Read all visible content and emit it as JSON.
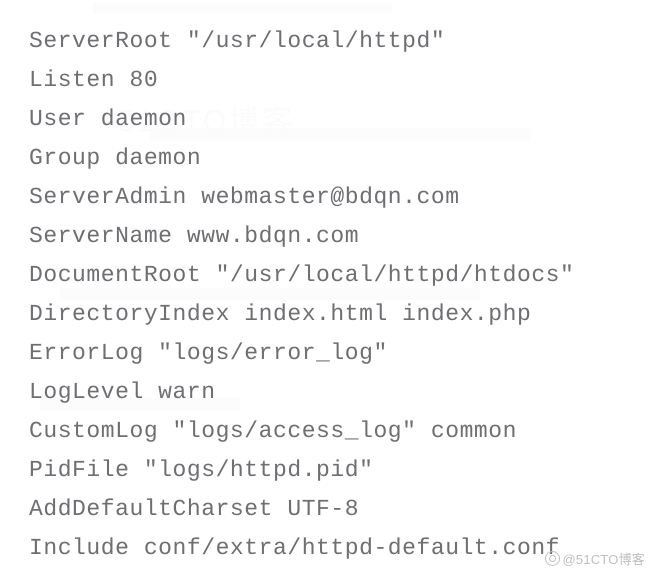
{
  "document": {
    "kind": "apache-httpd-config-listing",
    "background_color": "#ffffff",
    "text_color": "#6f6f73",
    "lines": [
      "ServerRoot \"/usr/local/httpd\"",
      "Listen 80",
      "User daemon",
      "Group daemon",
      "ServerAdmin webmaster@bdqn.com",
      "ServerName www.bdqn.com",
      "DocumentRoot \"/usr/local/httpd/htdocs\"",
      "DirectoryIndex index.html index.php",
      "ErrorLog \"logs/error_log\"",
      "LogLevel warn",
      "CustomLog \"logs/access_log\" common",
      "PidFile \"logs/httpd.pid\"",
      "AddDefaultCharset UTF-8",
      "Include conf/extra/httpd-default.conf"
    ]
  },
  "watermark": {
    "bottom_right_text": "@51CTO博客",
    "faint_background_text": "51CTO博客",
    "color": "#b9b9bd"
  }
}
